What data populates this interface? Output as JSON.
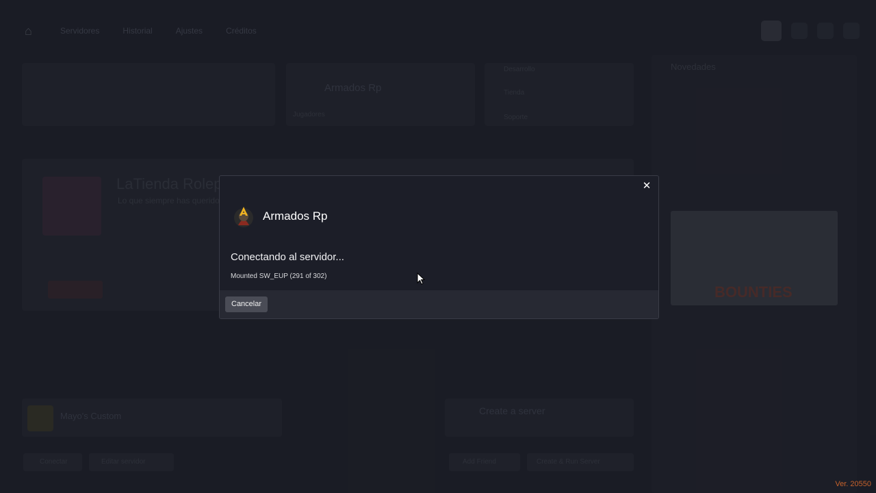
{
  "background": {
    "nav": [
      "Servidores",
      "Historial",
      "Ajustes",
      "Créditos"
    ],
    "featured_server": "Armados Rp",
    "featured_players": "Jugadores",
    "side_items": [
      "Desarrollo",
      "Tienda",
      "Soporte"
    ],
    "left_title": "LaTienda Roleplay",
    "left_subtitle": "Lo que siempre has querido...",
    "feed_title": "Novedades",
    "promo_word": "BOUNTIES",
    "bottom_server": "Mayo's Custom",
    "create_server": "Create a server",
    "bottom_buttons": [
      "Conectar",
      "Editar servidor",
      "Add Friend",
      "Create & Run Server"
    ]
  },
  "modal": {
    "server_name": "Armados Rp",
    "status_title": "Conectando al servidor...",
    "status_detail": "Mounted SW_EUP (291 of 302)",
    "cancel_label": "Cancelar",
    "close_symbol": "✕"
  },
  "version": "Ver. 20550",
  "colors": {
    "page_bg": "#23252f",
    "modal_bg": "#1c1e28",
    "footer_bg": "#272933",
    "version": "#c7622b"
  }
}
